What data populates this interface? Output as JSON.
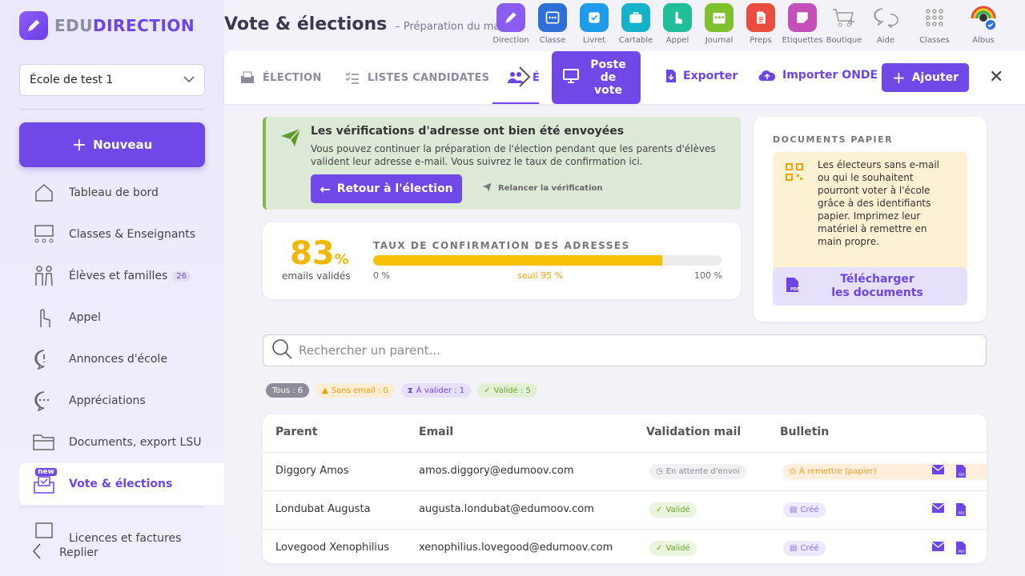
{
  "brand": {
    "prefix": "EDU",
    "name": "DIRECTION"
  },
  "sidebar": {
    "school": "École de test 1",
    "new_button": "Nouveau",
    "items": [
      {
        "label": "Tableau de bord",
        "icon": "home-icon"
      },
      {
        "label": "Classes & Enseignants",
        "icon": "classroom-icon"
      },
      {
        "label": "Élèves et familles",
        "icon": "family-icon",
        "badge": "26"
      },
      {
        "label": "Appel",
        "icon": "hand-icon"
      },
      {
        "label": "Annonces d'école",
        "icon": "announce-icon"
      },
      {
        "label": "Appréciations",
        "icon": "chat-icon"
      },
      {
        "label": "Documents, export LSU",
        "icon": "folder-icon"
      },
      {
        "label": "Vote & élections",
        "icon": "vote-icon",
        "tag": "new"
      },
      {
        "label": "Licences et factures",
        "icon": "invoice-icon"
      }
    ],
    "collapse": "Replier"
  },
  "header": {
    "title": "Vote & élections",
    "subtitle": "– Préparation du maté"
  },
  "apps": [
    {
      "label": "Direction",
      "color": "#8a5cf0",
      "icon": "pen-icon"
    },
    {
      "label": "Classe",
      "color": "#2f6fd8",
      "icon": "board-icon"
    },
    {
      "label": "Livret",
      "color": "#1e9be9",
      "icon": "check-icon"
    },
    {
      "label": "Cartable",
      "color": "#14b3c9",
      "icon": "briefcase-icon"
    },
    {
      "label": "Appel",
      "color": "#20bf9a",
      "icon": "hand-icon"
    },
    {
      "label": "Journal",
      "color": "#7fc02e",
      "icon": "calendar-icon"
    },
    {
      "label": "Preps",
      "color": "#ea4d3d",
      "icon": "doc-icon"
    },
    {
      "label": "Etiquettes",
      "color": "#c44fb8",
      "icon": "sticky-icon"
    },
    {
      "label": "Boutique",
      "color": "",
      "icon": "cart-icon"
    },
    {
      "label": "Aide",
      "color": "",
      "icon": "help-icon"
    },
    {
      "label": "Classes",
      "color": "",
      "icon": "grid-icon"
    },
    {
      "label": "Albus",
      "color": "",
      "icon": "avatar-icon"
    }
  ],
  "tabs": {
    "election": "ÉLECTION",
    "lists": "LISTES CANDIDATES",
    "voters": "ÉL"
  },
  "toolbar": {
    "poste": "Poste de vote",
    "export": "Exporter",
    "import": "Importer ONDE",
    "add": "Ajouter"
  },
  "alert": {
    "title": "Les vérifications d'adresse ont bien été envoyées",
    "text": "Vous pouvez continuer la préparation de l'élection pendant que les parents d'élèves validen​t leur adresse e-mail. Vous suivrez le taux de confirmation ici.",
    "back": "Retour à l'élection",
    "resend": "Relancer la vérification"
  },
  "stats": {
    "percent": "83",
    "percent_sign": "%",
    "percent_label": "emails validés",
    "rate_title": "TAUX DE CONFIRMATION DES ADRESSES",
    "progress": 0.83,
    "min": "0 %",
    "threshold": "seuil 95 %",
    "max": "100 %"
  },
  "paper": {
    "title": "DOCUMENTS PAPIER",
    "text": "Les électeurs sans e-mail ou qui le souhaitent pourront voter à l'école grâce à des identifiants papier. Imprimez leur matériel à remettre en main propre.",
    "download_line1": "Télécharger",
    "download_line2": "les documents"
  },
  "search": {
    "placeholder": "Rechercher un parent..."
  },
  "filters": {
    "all": "Tous : 6",
    "no_email": "Sans email : 0",
    "to_validate": "À valider : 1",
    "validated": "Validé : 5"
  },
  "table": {
    "headers": {
      "parent": "Parent",
      "email": "Email",
      "validation": "Validation mail",
      "bulletin": "Bulletin"
    },
    "rows": [
      {
        "parent": "Diggory Amos",
        "email": "amos.diggory@edumoov.com",
        "validation": "En attente d'envoi",
        "bulletin": "À remettre (papier)"
      },
      {
        "parent": "Londubat Augusta",
        "email": "augusta.londubat@edumoov.com",
        "validation": "Validé",
        "bulletin": "Créé"
      },
      {
        "parent": "Lovegood Xenophilius",
        "email": "xenophilius.lovegood@edumoov.com",
        "validation": "Validé",
        "bulletin": "Créé"
      }
    ]
  }
}
